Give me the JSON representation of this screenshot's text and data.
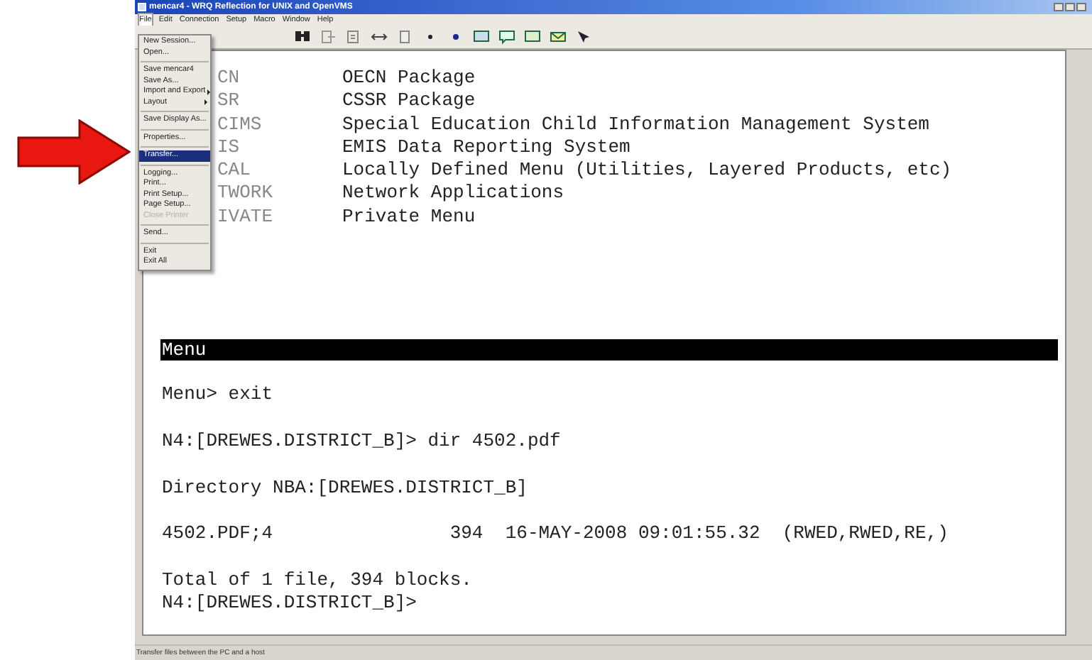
{
  "window": {
    "title": "mencar4 - WRQ Reflection for UNIX and OpenVMS"
  },
  "menubar": [
    {
      "label": "File",
      "selected": true
    },
    {
      "label": "Edit",
      "selected": false
    },
    {
      "label": "Connection",
      "selected": false
    },
    {
      "label": "Setup",
      "selected": false
    },
    {
      "label": "Macro",
      "selected": false
    },
    {
      "label": "Window",
      "selected": false
    },
    {
      "label": "Help",
      "selected": false
    }
  ],
  "file_menu": {
    "items": [
      {
        "kind": "item",
        "label": "New Session...",
        "selected": false,
        "disabled": false,
        "submenu": false
      },
      {
        "kind": "item",
        "label": "Open...",
        "selected": false,
        "disabled": false,
        "submenu": false
      },
      {
        "kind": "separator"
      },
      {
        "kind": "item",
        "label": "Save mencar4",
        "selected": false,
        "disabled": false,
        "submenu": false
      },
      {
        "kind": "item",
        "label": "Save As...",
        "selected": false,
        "disabled": false,
        "submenu": false
      },
      {
        "kind": "item",
        "label": "Import and Export",
        "selected": false,
        "disabled": false,
        "submenu": true
      },
      {
        "kind": "item",
        "label": "Layout",
        "selected": false,
        "disabled": false,
        "submenu": true
      },
      {
        "kind": "separator"
      },
      {
        "kind": "item",
        "label": "Save Display As...",
        "selected": false,
        "disabled": false,
        "submenu": false
      },
      {
        "kind": "separator"
      },
      {
        "kind": "item",
        "label": "Properties...",
        "selected": false,
        "disabled": false,
        "submenu": false
      },
      {
        "kind": "separator"
      },
      {
        "kind": "item",
        "label": "Transfer...",
        "selected": true,
        "disabled": false,
        "submenu": false
      },
      {
        "kind": "separator"
      },
      {
        "kind": "item",
        "label": "Logging...",
        "selected": false,
        "disabled": false,
        "submenu": false
      },
      {
        "kind": "item",
        "label": "Print...",
        "selected": false,
        "disabled": false,
        "submenu": false
      },
      {
        "kind": "item",
        "label": "Print Setup...",
        "selected": false,
        "disabled": false,
        "submenu": false
      },
      {
        "kind": "item",
        "label": "Page Setup...",
        "selected": false,
        "disabled": false,
        "submenu": false
      },
      {
        "kind": "item",
        "label": "Close Printer",
        "selected": false,
        "disabled": true,
        "submenu": false
      },
      {
        "kind": "separator"
      },
      {
        "kind": "item",
        "label": "Send...",
        "selected": false,
        "disabled": false,
        "submenu": false
      },
      {
        "kind": "separator"
      },
      {
        "kind": "item",
        "label": "Exit",
        "selected": false,
        "disabled": false,
        "submenu": false
      },
      {
        "kind": "item",
        "label": "Exit All",
        "selected": false,
        "disabled": false,
        "submenu": false
      }
    ]
  },
  "terminal": {
    "menu_entries": [
      {
        "code": "CN",
        "description": "OECN Package"
      },
      {
        "code": "SR",
        "description": "CSSR Package"
      },
      {
        "code": "CIMS",
        "description": "Special Education Child Information Management System"
      },
      {
        "code": "IS",
        "description": "EMIS Data Reporting System"
      },
      {
        "code": "CAL",
        "description": "Locally Defined Menu (Utilities, Layered Products, etc)"
      },
      {
        "code": "TWORK",
        "description": "Network Applications"
      },
      {
        "code": "IVATE",
        "description": "Private Menu"
      }
    ],
    "header_bar": "Menu",
    "blocks": [
      [
        "Menu> exit"
      ],
      [
        "N4:[DREWES.DISTRICT_B]> dir 4502.pdf"
      ],
      [
        "Directory NBA:[DREWES.DISTRICT_B]"
      ],
      [
        "4502.PDF;4                394  16-MAY-2008 09:01:55.32  (RWED,RWED,RE,)"
      ],
      [
        "Total of 1 file, 394 blocks.",
        "N4:[DREWES.DISTRICT_B]>"
      ]
    ]
  },
  "status_bar": "Transfer files between the PC and a host"
}
